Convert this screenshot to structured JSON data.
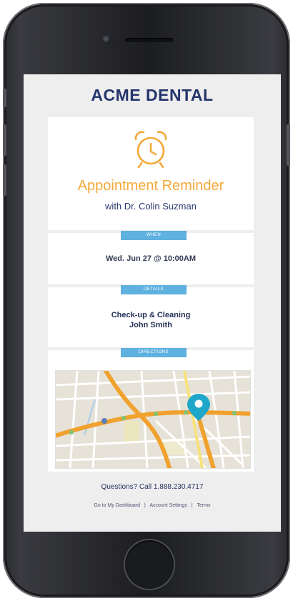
{
  "brand": "ACME DENTAL",
  "reminder": {
    "title": "Appointment Reminder",
    "subtitle": "with Dr. Colin Suzman"
  },
  "sections": {
    "when": {
      "label": "WHEN",
      "value": "Wed. Jun 27 @ 10:00AM"
    },
    "details": {
      "label": "DETAILS",
      "service": "Check-up & Cleaning",
      "patient": "John Smith"
    },
    "directions": {
      "label": "DIRECTIONS"
    }
  },
  "contact": "Questions? Call 1.888.230.4717",
  "footer_links": [
    "Go to My Dashboard",
    "Account Settings",
    "Terms"
  ],
  "footer_separator": "|",
  "icons": {
    "alarm": "alarm-clock-icon",
    "map_pin": "map-pin-icon"
  },
  "colors": {
    "brand": "#24356b",
    "accent_orange": "#f3a93a",
    "label_blue": "#5fb1e0",
    "map_pin": "#1ea7c9"
  }
}
